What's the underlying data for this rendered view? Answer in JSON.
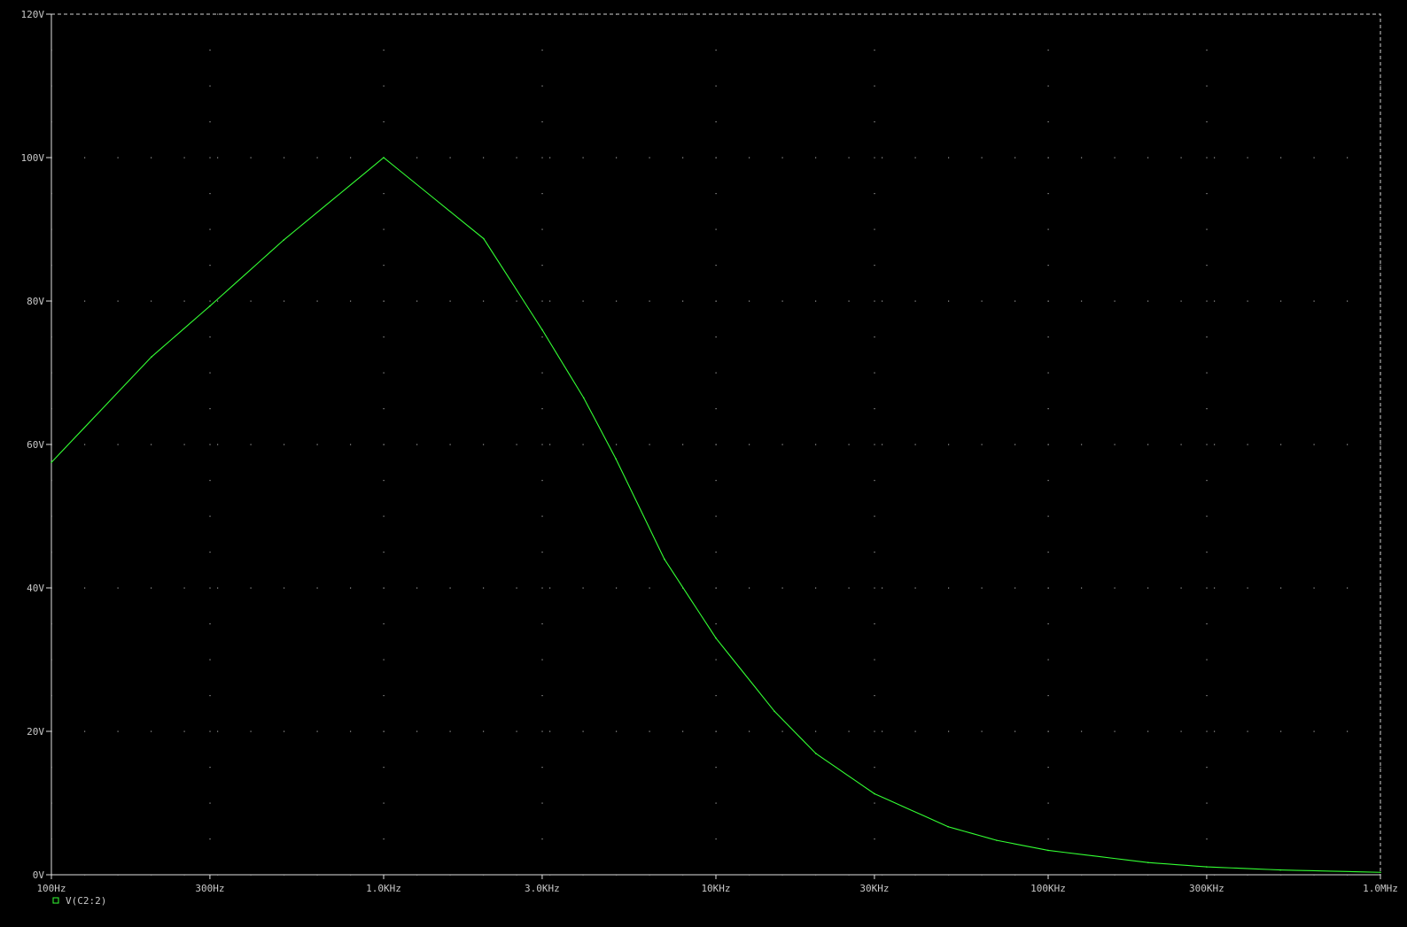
{
  "chart_data": {
    "type": "line",
    "xscale": "log",
    "xlim": [
      100,
      1000000
    ],
    "ylim": [
      0,
      120
    ],
    "grid": true,
    "x_ticks": [
      {
        "value": 100,
        "label": "100Hz"
      },
      {
        "value": 300,
        "label": "300Hz"
      },
      {
        "value": 1000,
        "label": "1.0KHz"
      },
      {
        "value": 3000,
        "label": "3.0KHz"
      },
      {
        "value": 10000,
        "label": "10KHz"
      },
      {
        "value": 30000,
        "label": "30KHz"
      },
      {
        "value": 100000,
        "label": "100KHz"
      },
      {
        "value": 300000,
        "label": "300KHz"
      },
      {
        "value": 1000000,
        "label": "1.0MHz"
      }
    ],
    "y_ticks": [
      {
        "value": 0,
        "label": "0V"
      },
      {
        "value": 20,
        "label": "20V"
      },
      {
        "value": 40,
        "label": "40V"
      },
      {
        "value": 60,
        "label": "60V"
      },
      {
        "value": 80,
        "label": "80V"
      },
      {
        "value": 100,
        "label": "100V"
      },
      {
        "value": 120,
        "label": "120V"
      }
    ],
    "series": [
      {
        "name": "V(C2:2)",
        "color": "#33ff33",
        "x": [
          100,
          200,
          300,
          500,
          1000,
          2000,
          3000,
          4000,
          5000,
          7000,
          10000,
          15000,
          20000,
          30000,
          50000,
          70000,
          100000,
          200000,
          300000,
          500000,
          1000000
        ],
        "y": [
          57.5,
          72.2,
          79.3,
          88.5,
          100.0,
          88.7,
          76.0,
          66.5,
          58.0,
          44.0,
          33.0,
          22.8,
          16.9,
          11.3,
          6.7,
          4.8,
          3.4,
          1.7,
          1.1,
          0.67,
          0.34
        ]
      }
    ]
  }
}
